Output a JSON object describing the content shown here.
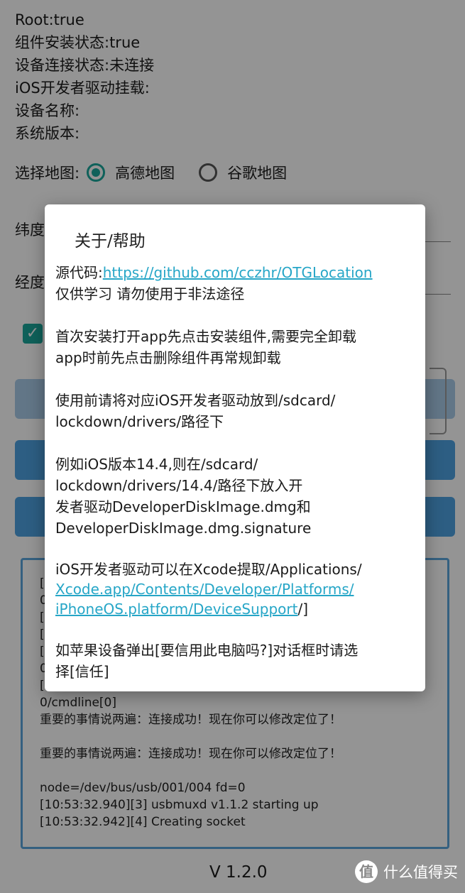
{
  "status": {
    "root": "Root:true",
    "component_install": "组件安装状态:true",
    "device_connect": "设备连接状态:未连接",
    "ios_driver_mount": "iOS开发者驱动挂载:",
    "device_name": "设备名称:",
    "system_version": "系统版本:"
  },
  "map_select": {
    "label": "选择地图:",
    "options": [
      "高德地图",
      "谷歌地图"
    ],
    "selected": "高德地图"
  },
  "fields": {
    "latitude_label": "纬度",
    "longitude_label": "经度"
  },
  "log": {
    "legend": "日",
    "lines": [
      "[1",
      "0",
      "[1",
      "[1",
      "[1",
      "0",
      "[1",
      "0/cmdline[0]",
      "重要的事情说两遍：连接成功！现在你可以修改定位了！",
      "",
      "重要的事情说两遍：连接成功！现在你可以修改定位了！",
      "",
      "node=/dev/bus/usb/001/004 fd=0",
      "[10:53:32.940][3] usbmuxd v1.1.2 starting up",
      "[10:53:32.942][4] Creating socket"
    ]
  },
  "version": "V 1.2.0",
  "dialog": {
    "title": "关于/帮助",
    "source_label": "源代码:",
    "source_link": "https://github.com/cczhr/OTGLocation",
    "disclaimer": "仅供学习 请勿使用于非法途径",
    "p1_line1": "首次安装打开app先点击安装组件,需要完全卸载",
    "p1_line2": "app时前先点击删除组件再常规卸载",
    "p2_line1": "使用前请将对应iOS开发者驱动放到/sdcard/",
    "p2_line2": "lockdown/drivers/路径下",
    "p3_line1": "例如iOS版本14.4,则在/sdcard/",
    "p3_line2": "lockdown/drivers/14.4/路径下放入开",
    "p3_line3": "发者驱动DeveloperDiskImage.dmg和",
    "p3_line4": "DeveloperDiskImage.dmg.signature",
    "p4_line1": "iOS开发者驱动可以在Xcode提取/Applications/",
    "p4_link_line2": "Xcode.app/Contents/Developer/Platforms/",
    "p4_link_line3": "iPhoneOS.platform/DeviceSupport",
    "p4_tail": "/]",
    "p5_line1": "如苹果设备弹出[要信用此电脑吗?]对话框时请选",
    "p5_line2": "择[信任]"
  },
  "watermark": {
    "badge": "值",
    "text": "什么值得买"
  },
  "colors": {
    "accent": "#1aa79b",
    "button": "#4ea3e2",
    "link": "#26a6c7"
  }
}
